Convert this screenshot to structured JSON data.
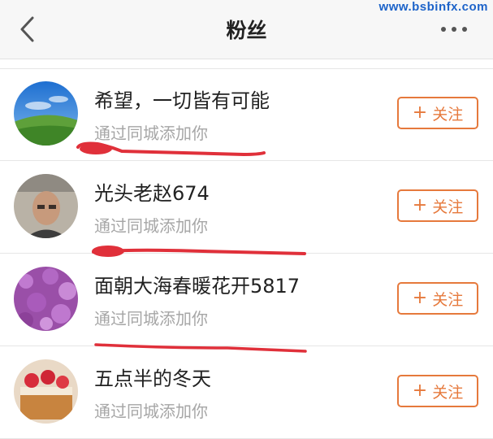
{
  "watermark": "www.bsbinfx.com",
  "header": {
    "title": "粉丝",
    "back_icon": "chevron-left-icon",
    "more_icon": "more-horizontal-icon"
  },
  "colors": {
    "accent": "#e6793c",
    "annotation": "#e0303a",
    "watermark": "#1d63c9"
  },
  "followers": [
    {
      "name": "希望，一切皆有可能",
      "source": "通过同城添加你",
      "button_plus": "+",
      "button_label": "关注"
    },
    {
      "name": "光头老赵674",
      "source": "通过同城添加你",
      "button_plus": "+",
      "button_label": "关注"
    },
    {
      "name": "面朝大海春暖花开5817",
      "source": "通过同城添加你",
      "button_plus": "+",
      "button_label": "关注"
    },
    {
      "name": "五点半的冬天",
      "source": "通过同城添加你",
      "button_plus": "+",
      "button_label": "关注"
    }
  ]
}
